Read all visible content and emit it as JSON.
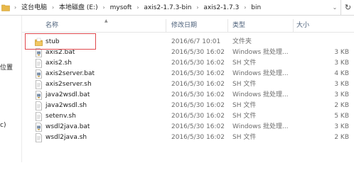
{
  "breadcrumb": {
    "items": [
      "这台电脑",
      "本地磁盘 (E:)",
      "mysoft",
      "axis2-1.7.3-bin",
      "axis2-1.7.3",
      "bin"
    ],
    "separator": "›"
  },
  "nav": {
    "labels": [
      "位置",
      "c)"
    ]
  },
  "columns": {
    "name": "名称",
    "date": "修改日期",
    "type": "类型",
    "size": "大小"
  },
  "files": [
    {
      "name": "stub",
      "date": "2016/6/7 10:01",
      "type": "文件夹",
      "size": "",
      "icon": "folder-icon"
    },
    {
      "name": "axis2.bat",
      "date": "2016/5/30 16:02",
      "type": "Windows 批处理...",
      "size": "3 KB",
      "icon": "bat-file-icon"
    },
    {
      "name": "axis2.sh",
      "date": "2016/5/30 16:02",
      "type": "SH 文件",
      "size": "3 KB",
      "icon": "sh-file-icon"
    },
    {
      "name": "axis2server.bat",
      "date": "2016/5/30 16:02",
      "type": "Windows 批处理...",
      "size": "4 KB",
      "icon": "bat-file-icon"
    },
    {
      "name": "axis2server.sh",
      "date": "2016/5/30 16:02",
      "type": "SH 文件",
      "size": "3 KB",
      "icon": "sh-file-icon"
    },
    {
      "name": "java2wsdl.bat",
      "date": "2016/5/30 16:02",
      "type": "Windows 批处理...",
      "size": "3 KB",
      "icon": "bat-file-icon"
    },
    {
      "name": "java2wsdl.sh",
      "date": "2016/5/30 16:02",
      "type": "SH 文件",
      "size": "2 KB",
      "icon": "sh-file-icon"
    },
    {
      "name": "setenv.sh",
      "date": "2016/5/30 16:02",
      "type": "SH 文件",
      "size": "5 KB",
      "icon": "sh-file-icon"
    },
    {
      "name": "wsdl2java.bat",
      "date": "2016/5/30 16:02",
      "type": "Windows 批处理...",
      "size": "3 KB",
      "icon": "bat-file-icon"
    },
    {
      "name": "wsdl2java.sh",
      "date": "2016/5/30 16:02",
      "type": "SH 文件",
      "size": "2 KB",
      "icon": "sh-file-icon"
    }
  ],
  "colors": {
    "folder": "#e8b84a",
    "highlight": "#e0494e",
    "header_text": "#4c607a"
  }
}
